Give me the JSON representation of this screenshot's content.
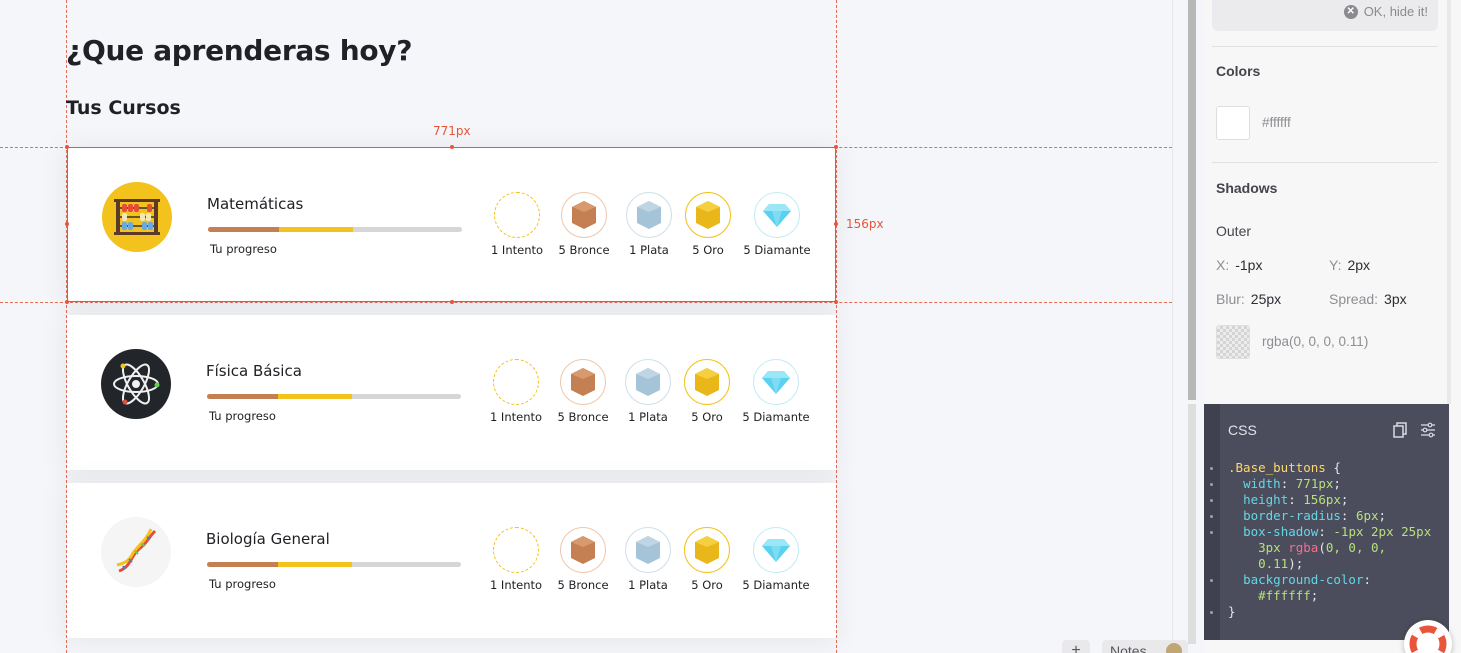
{
  "page": {
    "heading": "¿Que aprenderas hoy?",
    "subheading": "Tus Cursos"
  },
  "measure": {
    "width_label": "771px",
    "height_label": "156px"
  },
  "progress_label": "Tu progreso",
  "medals": [
    {
      "type": "attempt",
      "label": "1 Intento",
      "icon": "dashed-circle-icon"
    },
    {
      "type": "bronze",
      "label": "5 Bronce",
      "icon": "bronze-medal-icon"
    },
    {
      "type": "silver",
      "label": "1 Plata",
      "icon": "silver-medal-icon"
    },
    {
      "type": "gold",
      "label": "5 Oro",
      "icon": "gold-medal-icon"
    },
    {
      "type": "diamond",
      "label": "5 Diamante",
      "icon": "diamond-icon"
    }
  ],
  "courses": [
    {
      "name": "Matemáticas",
      "icon": "abacus-icon",
      "progress_bronze": 0.28,
      "progress_gold": 0.57
    },
    {
      "name": "Física Básica",
      "icon": "atom-icon",
      "progress_bronze": 0.28,
      "progress_gold": 0.57
    },
    {
      "name": "Biología General",
      "icon": "dna-icon",
      "progress_bronze": 0.28,
      "progress_gold": 0.57
    }
  ],
  "panel": {
    "notice_button": "OK, hide it!",
    "colors_title": "Colors",
    "color_value": "#ffffff",
    "shadows_title": "Shadows",
    "outer_label": "Outer",
    "x_key": "X:",
    "x_val": "-1px",
    "y_key": "Y:",
    "y_val": "2px",
    "blur_key": "Blur:",
    "blur_val": "25px",
    "spread_key": "Spread:",
    "spread_val": "3px",
    "shadow_color": "rgba(0, 0, 0, 0.11)",
    "css_title": "CSS"
  },
  "css_code": {
    "selector": ".Base_buttons",
    "width_prop": "width",
    "width_val": "771px",
    "height_prop": "height",
    "height_val": "156px",
    "radius_prop": "border-radius",
    "radius_val": "6px",
    "shadow_prop": "box-shadow",
    "shadow_val_1": "-1px 2px 25px",
    "shadow_val_2": "3px",
    "shadow_fn": "rgba",
    "shadow_args_1": "0, 0, 0,",
    "shadow_args_2": "0.11",
    "bg_prop": "background-color",
    "bg_val": "#ffffff"
  },
  "bottom": {
    "plus_label": "+",
    "notes_label": "Notes"
  },
  "colors": {
    "accent_guide": "#e8553a",
    "bronze": "#c47f52",
    "gold": "#f4c21d",
    "silver": "#a6c4d8",
    "diamond": "#5ad1f0"
  }
}
